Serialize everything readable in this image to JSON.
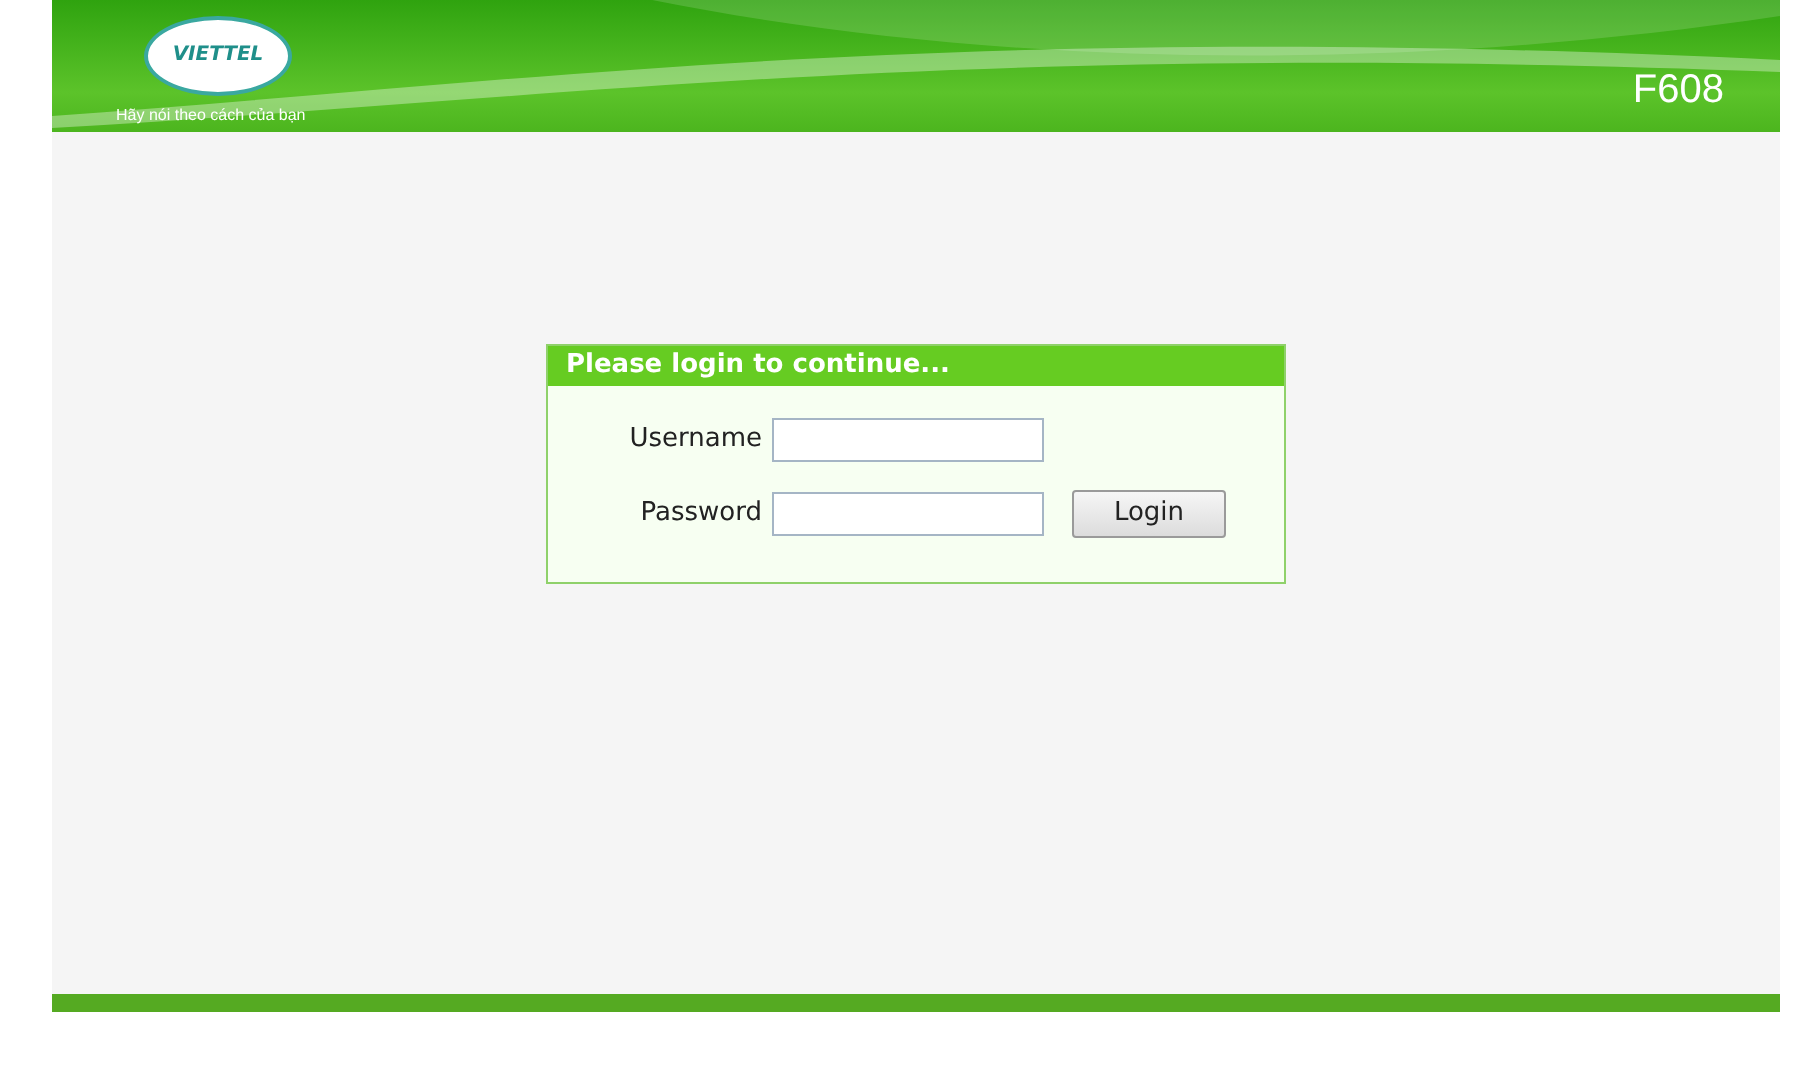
{
  "header": {
    "logo_text": "VIETTEL",
    "slogan": "Hãy nói theo cách của bạn",
    "model": "F608"
  },
  "login": {
    "title": "Please login to continue...",
    "fields": [
      {
        "label": "Username"
      },
      {
        "label": "Password"
      }
    ],
    "button": "Login"
  }
}
